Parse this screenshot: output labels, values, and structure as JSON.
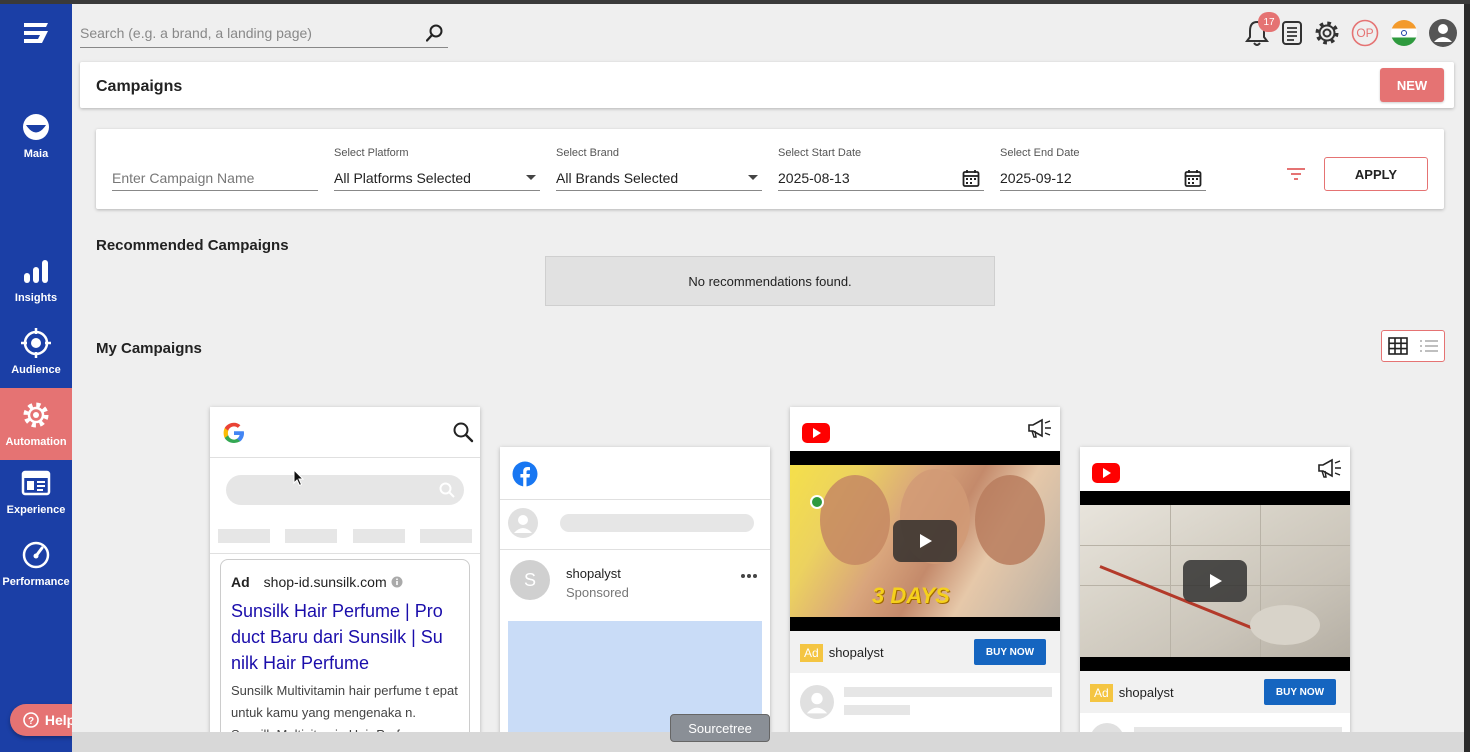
{
  "search": {
    "placeholder": "Search (e.g. a brand, a landing page)"
  },
  "notifications": {
    "count": "17"
  },
  "user": {
    "initials": "OP"
  },
  "sidebar": {
    "items": [
      {
        "label": "Maia",
        "icon": "maia-icon"
      },
      {
        "label": "Insights",
        "icon": "bar-chart-icon"
      },
      {
        "label": "Audience",
        "icon": "target-icon"
      },
      {
        "label": "Automation",
        "icon": "gear-icon"
      },
      {
        "label": "Experience",
        "icon": "browser-window-icon"
      },
      {
        "label": "Performance",
        "icon": "speedometer-icon"
      }
    ],
    "active": "Automation",
    "help_label": "Help"
  },
  "header": {
    "title": "Campaigns",
    "new_label": "NEW"
  },
  "filters": {
    "campaign_placeholder": "Enter Campaign Name",
    "platform_label": "Select Platform",
    "platform_value": "All Platforms Selected",
    "brand_label": "Select Brand",
    "brand_value": "All Brands Selected",
    "start_label": "Select Start Date",
    "start_value": "2025-08-13",
    "end_label": "Select End Date",
    "end_value": "2025-09-12",
    "apply_label": "APPLY"
  },
  "recommended": {
    "title": "Recommended Campaigns",
    "empty": "No recommendations found."
  },
  "my_campaigns": {
    "title": "My Campaigns",
    "google": {
      "ad_tag": "Ad",
      "domain": "shop-id.sunsilk.com",
      "headline": "Sunsilk Hair Perfume | Pro duct Baru dari Sunsilk | Su nilk Hair Perfume",
      "description": "Sunsilk Multivitamin hair perfume t epat untuk kamu yang mengenaka n. Sunsilk Multivitamin Hair Perfum"
    },
    "facebook": {
      "avatar_letter": "S",
      "page_name": "shopalyst",
      "sponsored": "Sponsored"
    },
    "youtube1": {
      "ad_tag": "Ad",
      "channel": "shopalyst",
      "cta": "BUY NOW",
      "overlay_text": "3 DAYS"
    },
    "youtube2": {
      "ad_tag": "Ad",
      "channel": "shopalyst",
      "cta": "BUY NOW"
    }
  },
  "tooltip": {
    "text": "Sourcetree"
  },
  "colors": {
    "sidebar": "#1b3fa6",
    "accent": "#e57373",
    "cta": "#1565c0"
  }
}
